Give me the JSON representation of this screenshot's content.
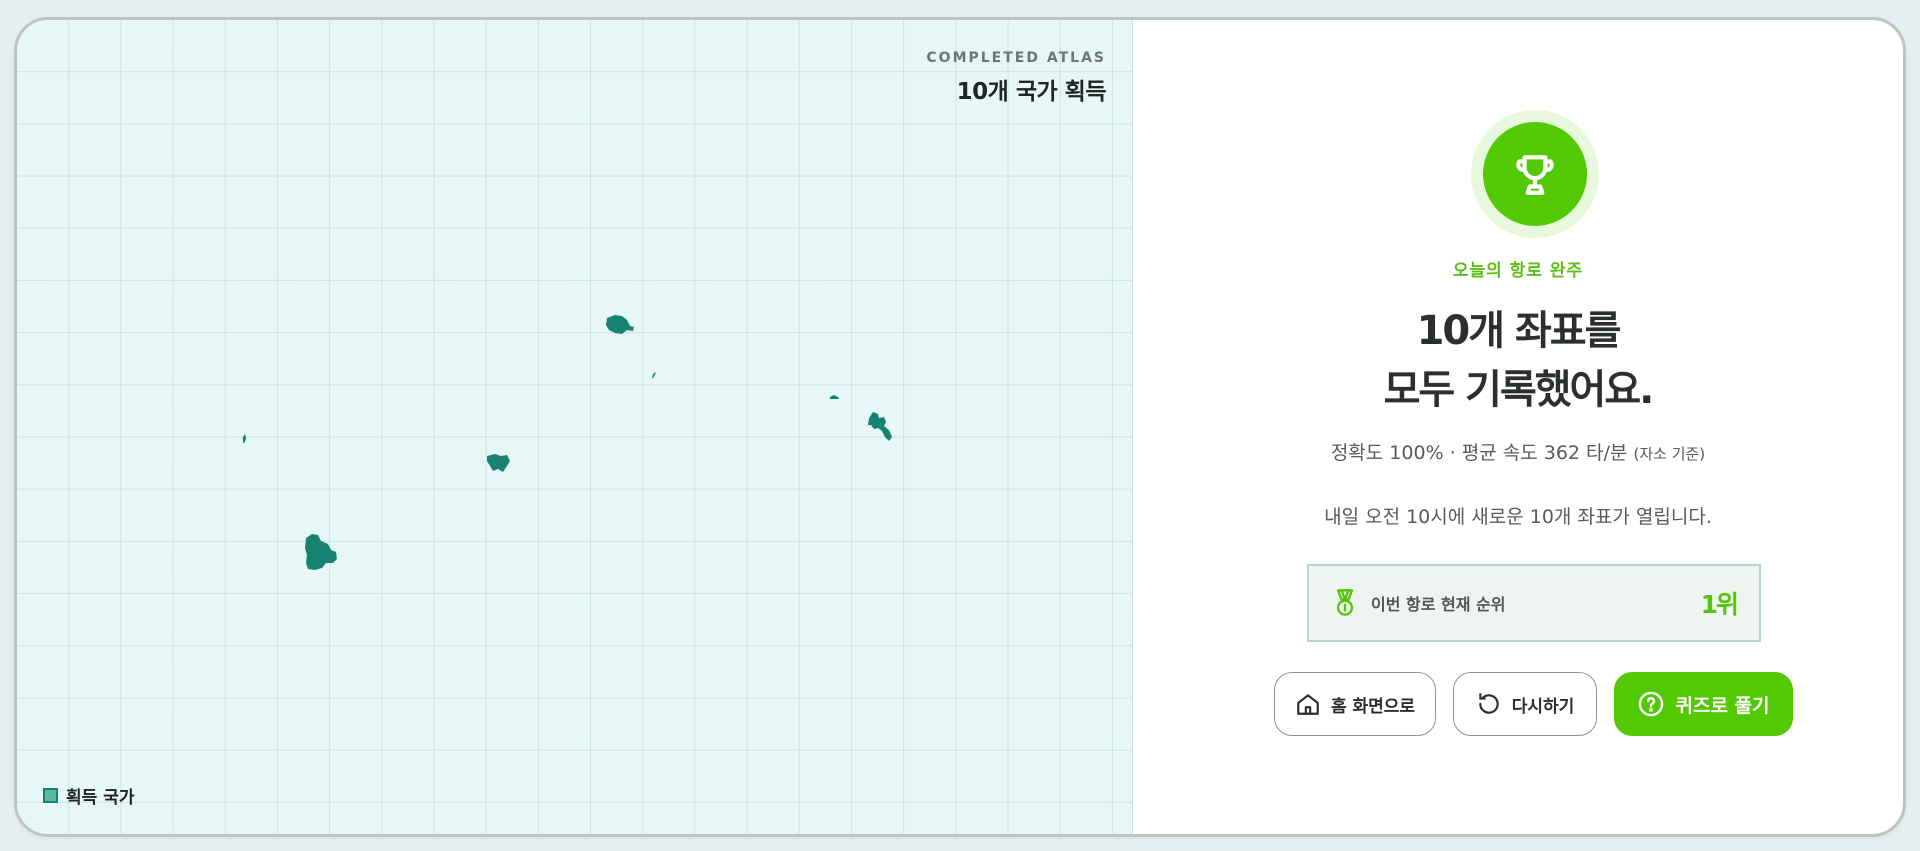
{
  "atlas": {
    "kicker": "COMPLETED ATLAS",
    "title": "10개 국가 획득",
    "legend_label": "획득 국가",
    "country_color": "#168372",
    "grid_color": "#96c3cd"
  },
  "result": {
    "icon": "trophy-icon",
    "kicker": "오늘의 항로 완주",
    "headline_line1": "10개 좌표를",
    "headline_line2": "모두 기록했어요.",
    "stats_main": "정확도 100% · 평균 속도 362 타/분",
    "stats_note": "(자소 기준)",
    "next_notice": "내일 오전 10시에 새로운 10개 좌표가 열립니다.",
    "accent_color": "#53c805"
  },
  "rank": {
    "icon": "medal-icon",
    "label": "이번 항로 현재 순위",
    "value": "1위"
  },
  "buttons": {
    "home": {
      "label": "홈 화면으로",
      "icon": "home-icon"
    },
    "retry": {
      "label": "다시하기",
      "icon": "refresh-icon"
    },
    "quiz": {
      "label": "퀴즈로 풀기",
      "icon": "question-circle-icon"
    }
  }
}
